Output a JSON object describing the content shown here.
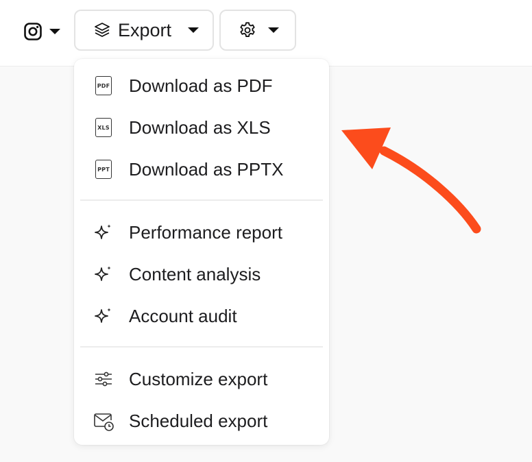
{
  "toolbar": {
    "instagram_icon": "instagram-icon",
    "export_label": "Export",
    "export_icon": "layers-icon",
    "settings_icon": "gear-icon"
  },
  "menu": {
    "downloads": [
      {
        "label": "Download as PDF",
        "badge": "PDF",
        "icon": "pdf-file-icon"
      },
      {
        "label": "Download as XLS",
        "badge": "XLS",
        "icon": "xls-file-icon"
      },
      {
        "label": "Download as PPTX",
        "badge": "PPT",
        "icon": "ppt-file-icon"
      }
    ],
    "ai_reports": [
      {
        "label": "Performance report",
        "icon": "sparkles-icon"
      },
      {
        "label": "Content analysis",
        "icon": "sparkles-icon"
      },
      {
        "label": "Account audit",
        "icon": "sparkles-icon"
      }
    ],
    "settings": [
      {
        "label": "Customize export",
        "icon": "sliders-icon"
      },
      {
        "label": "Scheduled export",
        "icon": "mail-clock-icon"
      }
    ]
  },
  "annotation": {
    "arrow_color": "#fc4c1c"
  }
}
